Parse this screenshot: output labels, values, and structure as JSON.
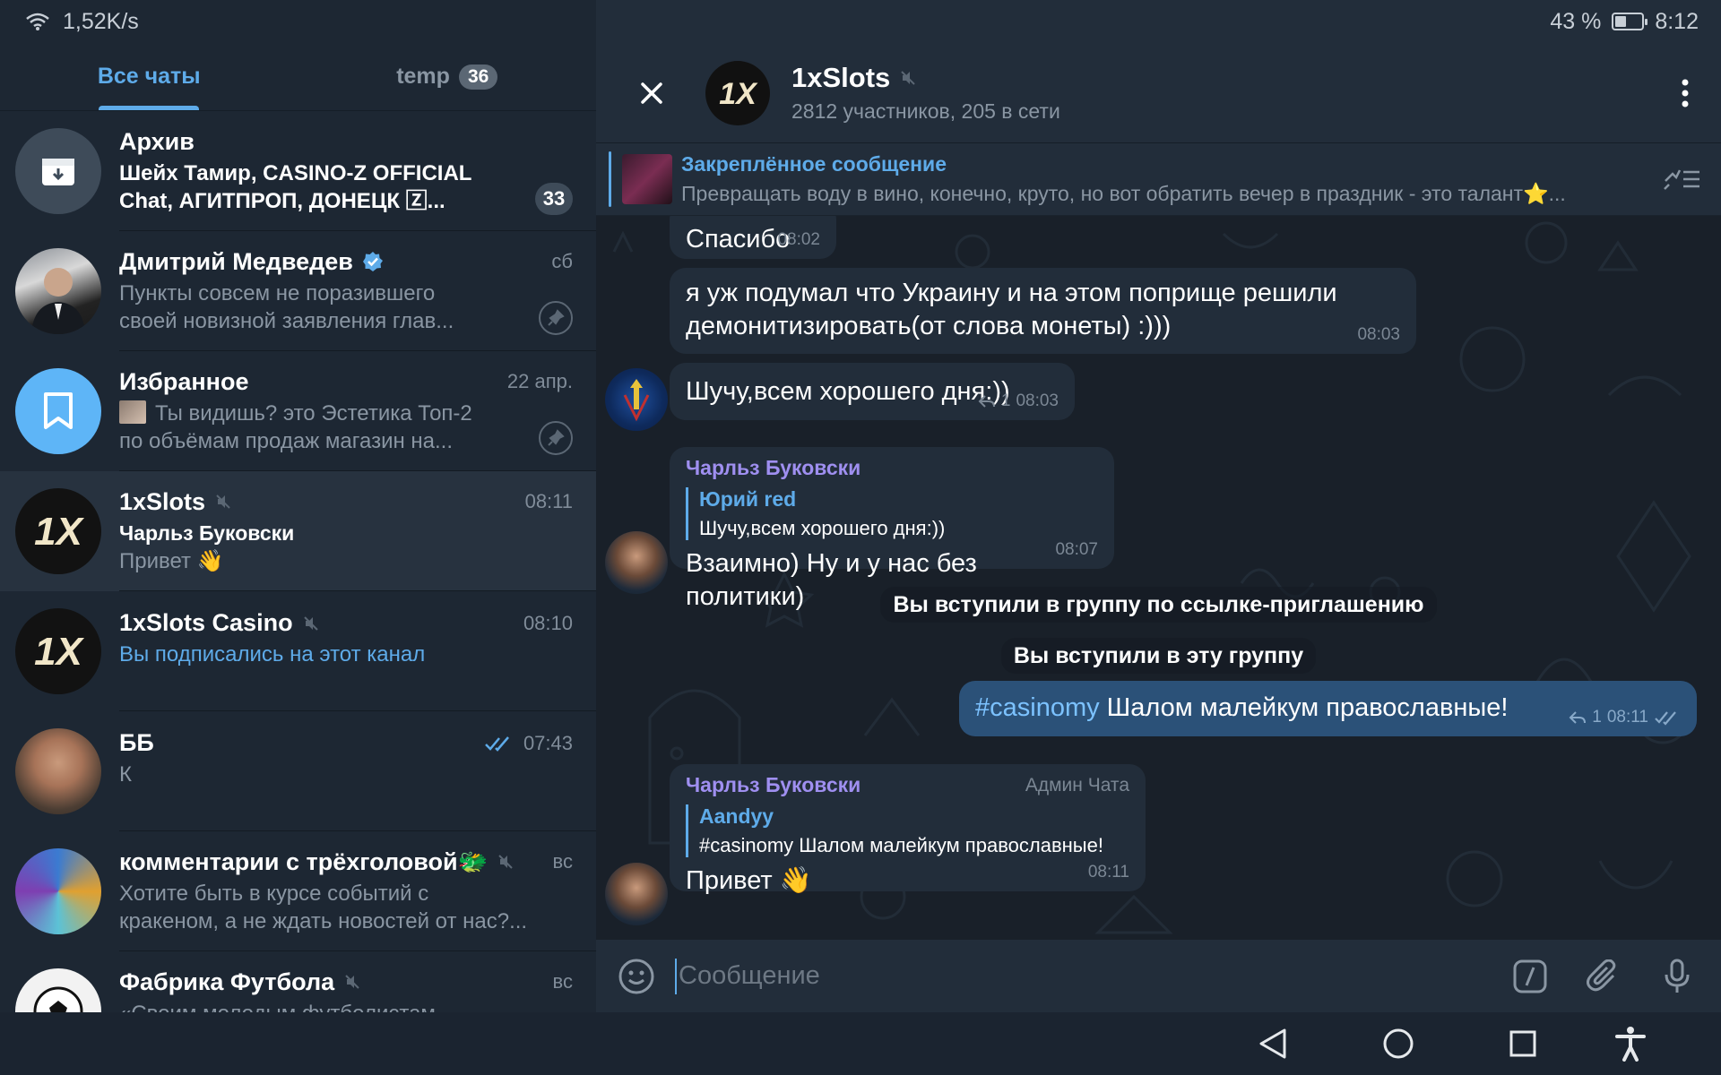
{
  "status_bar": {
    "network_speed": "1,52K/s",
    "battery_percent": "43 %",
    "battery_level": 0.43,
    "time": "8:12"
  },
  "tabs": [
    {
      "label": "Все чаты",
      "active": true
    },
    {
      "label": "temp",
      "badge": "36"
    }
  ],
  "chats": [
    {
      "title": "Архив",
      "preview_line1": "Шейх Тамир, CASINO-Z OFFICIAL",
      "preview_line2": "Chat, АГИТПРОП, ДОНЕЦК 🅉...",
      "badge": "33"
    },
    {
      "title": "Дмитрий Медведев",
      "verified": true,
      "time": "сб",
      "preview_line1": "Пункты совсем не поразившего",
      "preview_line2": "своей новизной заявления глав...",
      "pinned": true
    },
    {
      "title": "Избранное",
      "time": "22 апр.",
      "preview_line1": "Ты видишь? это Эстетика  Топ-2",
      "preview_line2": "по объёмам продаж магазин на...",
      "pinned": true
    },
    {
      "title": "1xSlots",
      "muted": true,
      "time": "08:11",
      "sender": "Чарльз Буковски",
      "preview_line1": "Привет 👋"
    },
    {
      "title": "1xSlots Casino",
      "muted": true,
      "time": "08:10",
      "preview_line1": "Вы подписались на этот канал"
    },
    {
      "title": "ББ",
      "time": "07:43",
      "read": true,
      "preview_line1": "К"
    },
    {
      "title": "комментарии с трёхголовой🐲",
      "muted": true,
      "time": "вс",
      "preview_line1": "Хотите быть в курсе событий с",
      "preview_line2": "кракеном, а не ждать новостей от нас?..."
    },
    {
      "title": "Фабрика Футбола",
      "muted": true,
      "time": "вс",
      "preview_line1": "«Своим молодым футболистам хочется"
    }
  ],
  "header": {
    "title": "1xSlots",
    "subtitle": "2812 участников, 205 в сети"
  },
  "pinned": {
    "title": "Закреплённое сообщение",
    "text": "Превращать воду в вино, конечно, круто, но вот обратить вечер в праздник - это талант⭐..."
  },
  "messages": {
    "m1": {
      "text": "Спасибо",
      "time": "08:02"
    },
    "m2": {
      "text_line1": "я уж подумал что Украину и на этом поприще решили",
      "text_line2": "демонитизировать(от слова монеты)  :)))",
      "time": "08:03"
    },
    "m3": {
      "text": "Шучу,всем хорошего дня:))",
      "replies": "1",
      "time": "08:03"
    },
    "m4": {
      "sender": "Чарльз Буковски",
      "reply_name": "Юрий red",
      "reply_text": "Шучу,всем хорошего дня:))",
      "text": "Взаимно) Ну и у нас без политики)",
      "time": "08:07"
    },
    "service1": "Вы вступили в группу по ссылке-приглашению",
    "service2": "Вы вступили в эту группу",
    "m5": {
      "hashtag": "#casinomy",
      "text": " Шалом малейкум православные!",
      "replies": "1",
      "time": "08:11"
    },
    "m6": {
      "sender": "Чарльз Буковски",
      "role": "Админ Чата",
      "reply_name": "Aandyy",
      "reply_text": "#casinomy Шалом малейкум православные!",
      "text": "Привет 👋",
      "time": "08:11"
    }
  },
  "composer": {
    "placeholder": "Сообщение"
  },
  "colors": {
    "accent": "#5eabe9",
    "background": "#1d2733",
    "outgoing": "#2b5178",
    "sender_name": "#9f8ff0"
  },
  "icons": [
    "wifi-icon",
    "battery-icon",
    "archive-icon",
    "verified-icon",
    "pin-icon",
    "bookmark-icon",
    "mute-icon",
    "double-check-icon",
    "close-icon",
    "more-icon",
    "pinned-list-icon",
    "reply-icon",
    "emoji-icon",
    "command-icon",
    "attach-icon",
    "mic-icon",
    "back-icon",
    "home-icon",
    "recents-icon",
    "accessibility-icon"
  ]
}
